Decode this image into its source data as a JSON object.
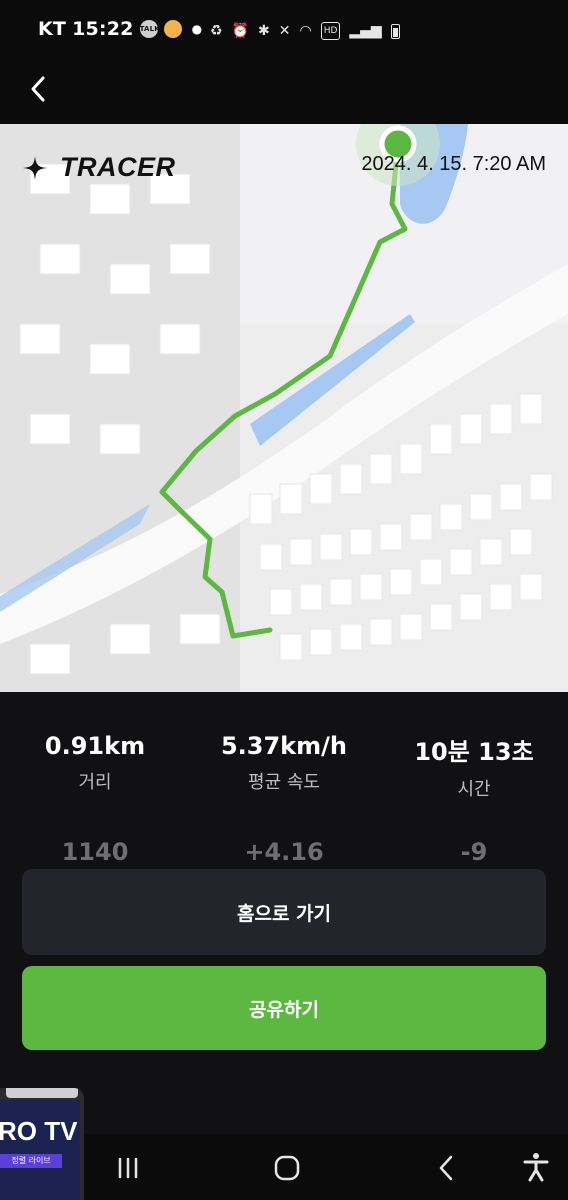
{
  "status_bar": {
    "carrier": "KT",
    "time": "15:22",
    "talk_label": "TALK"
  },
  "header": {
    "back_icon": "chevron-left-icon"
  },
  "map_card": {
    "brand": "TRACER",
    "datetime": "2024. 4. 15. 7:20 AM",
    "route_color": "#5cb841",
    "water_color": "#a7c8f2"
  },
  "stats": [
    {
      "value": "0.91km",
      "label": "거리"
    },
    {
      "value": "5.37km/h",
      "label": "평균 속도"
    },
    {
      "value": "10분 13초",
      "label": "시간"
    }
  ],
  "faded_stats": [
    "1140",
    "+4.16",
    "-9"
  ],
  "buttons": {
    "home": "홈으로 가기",
    "share": "공유하기"
  },
  "pip": {
    "title": "RO TV",
    "subtitle": "정렬 라이브"
  },
  "colors": {
    "background": "#111113",
    "accent": "#5cb841",
    "secondary_button": "#24242c"
  }
}
